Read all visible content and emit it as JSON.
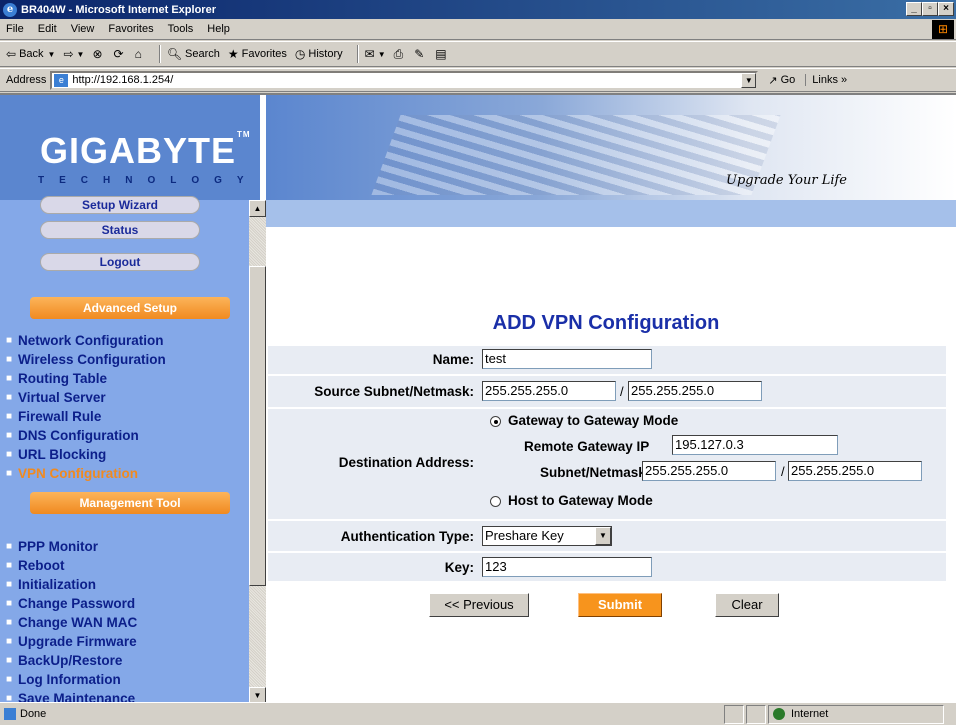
{
  "window": {
    "title": "BR404W - Microsoft Internet Explorer"
  },
  "menu": [
    "File",
    "Edit",
    "View",
    "Favorites",
    "Tools",
    "Help"
  ],
  "toolbar": {
    "back": "Back",
    "search": "Search",
    "favorites": "Favorites",
    "history": "History"
  },
  "address": {
    "label": "Address",
    "url": "http://192.168.1.254/",
    "go": "Go",
    "links": "Links"
  },
  "brand": {
    "logo": "GIGABYTE",
    "tagline": "TECHNOLOGY",
    "slogan": "Upgrade Your Life"
  },
  "sidebar": {
    "buttons": [
      "Setup Wizard",
      "Status",
      "Logout"
    ],
    "advanced_header": "Advanced Setup",
    "advanced_items": [
      "Network Configuration",
      "Wireless Configuration",
      "Routing Table",
      "Virtual Server",
      "Firewall Rule",
      "DNS Configuration",
      "URL Blocking",
      "VPN Configuration"
    ],
    "management_header": "Management Tool",
    "management_items": [
      "PPP Monitor",
      "Reboot",
      "Initialization",
      "Change Password",
      "Change WAN MAC",
      "Upgrade Firmware",
      "BackUp/Restore",
      "Log Information",
      "Save Maintenance"
    ]
  },
  "form": {
    "title": "ADD VPN Configuration",
    "name_label": "Name:",
    "name_value": "test",
    "source_label": "Source Subnet/Netmask:",
    "source_subnet": "255.255.255.0",
    "source_netmask": "255.255.255.0",
    "dest_label": "Destination Address:",
    "gw_mode": "Gateway to Gateway Mode",
    "remote_gw_label": "Remote Gateway IP",
    "remote_gw_value": "195.127.0.3",
    "subnet_label": "Subnet/Netmask",
    "dest_subnet": "255.255.255.0",
    "dest_netmask": "255.255.255.0",
    "host_mode": "Host to Gateway Mode",
    "auth_label": "Authentication Type:",
    "auth_value": "Preshare Key",
    "key_label": "Key:",
    "key_value": "123",
    "slash": "/",
    "prev_btn": "<< Previous",
    "submit_btn": "Submit",
    "clear_btn": "Clear"
  },
  "status": {
    "left": "Done",
    "zone": "Internet"
  }
}
